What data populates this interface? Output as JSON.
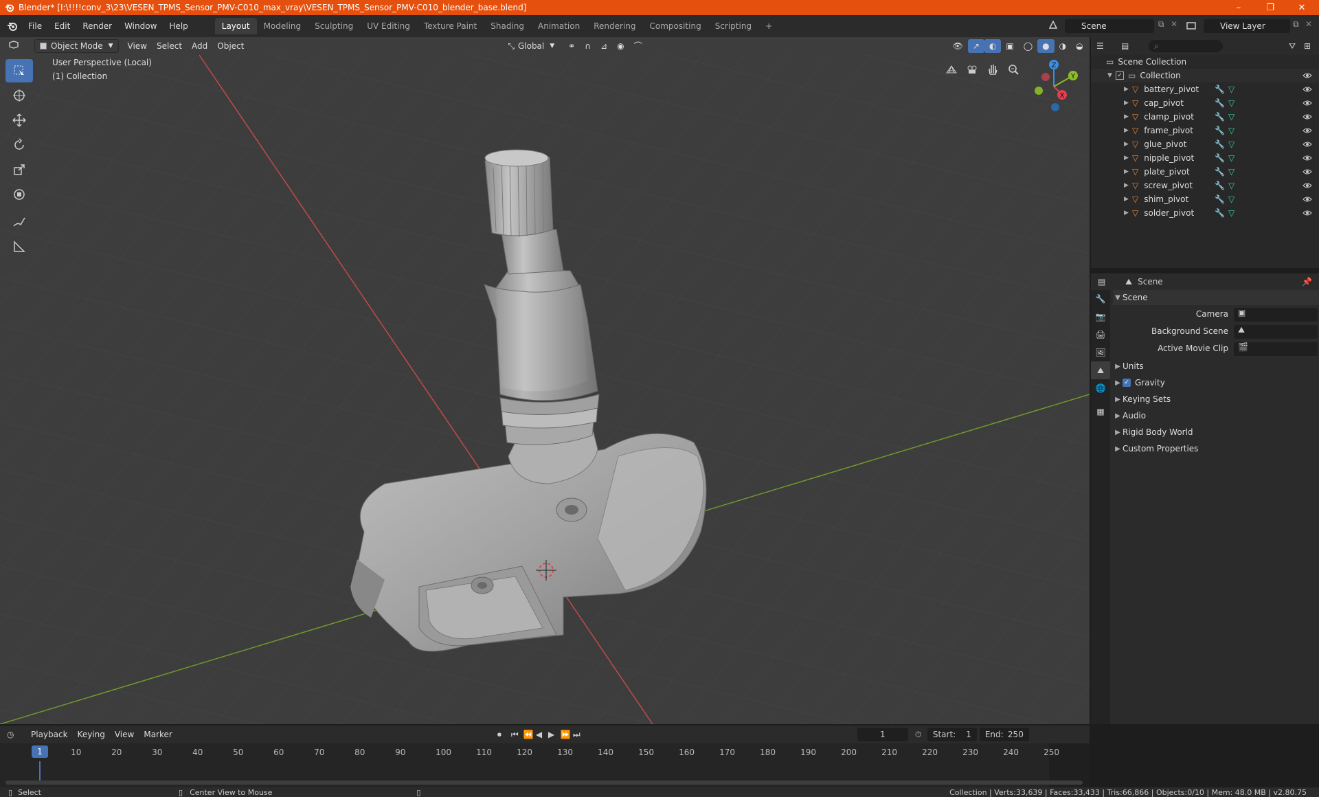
{
  "window": {
    "title": "Blender* [I:\\!!!!conv_3\\23\\VESEN_TPMS_Sensor_PMV-C010_max_vray\\VESEN_TPMS_Sensor_PMV-C010_blender_base.blend]",
    "minimize": "–",
    "maximize": "❐",
    "close": "✕"
  },
  "menubar": {
    "items": [
      "File",
      "Edit",
      "Render",
      "Window",
      "Help"
    ],
    "workspaces": [
      "Layout",
      "Modeling",
      "Sculpting",
      "UV Editing",
      "Texture Paint",
      "Shading",
      "Animation",
      "Rendering",
      "Compositing",
      "Scripting"
    ],
    "add_workspace": "+",
    "scene": "Scene",
    "view_layer": "View Layer"
  },
  "viewport": {
    "mode": "Object Mode",
    "menus": [
      "View",
      "Select",
      "Add",
      "Object"
    ],
    "transform": "Global",
    "perspective": "User Perspective (Local)",
    "collection": "(1) Collection",
    "gizmo": {
      "x": "X",
      "y": "Y",
      "z": "Z"
    }
  },
  "outliner": {
    "root": "Scene Collection",
    "collection": "Collection",
    "objects": [
      "battery_pivot",
      "cap_pivot",
      "clamp_pivot",
      "frame_pivot",
      "glue_pivot",
      "nipple_pivot",
      "plate_pivot",
      "screw_pivot",
      "shim_pivot",
      "solder_pivot"
    ]
  },
  "properties": {
    "context": "Scene",
    "panel": "Scene",
    "camera_label": "Camera",
    "bg_scene_label": "Background Scene",
    "movie_clip_label": "Active Movie Clip",
    "sections": [
      "Units",
      "Gravity",
      "Keying Sets",
      "Audio",
      "Rigid Body World",
      "Custom Properties"
    ]
  },
  "timeline": {
    "menus": [
      "Playback",
      "Keying",
      "View",
      "Marker"
    ],
    "current_frame": "1",
    "start_label": "Start:",
    "start": "1",
    "end_label": "End:",
    "end": "250",
    "ticks": [
      "1",
      "10",
      "20",
      "30",
      "40",
      "50",
      "60",
      "70",
      "80",
      "90",
      "100",
      "110",
      "120",
      "130",
      "140",
      "150",
      "160",
      "170",
      "180",
      "190",
      "200",
      "210",
      "220",
      "230",
      "240",
      "250"
    ]
  },
  "statusbar": {
    "select": "Select",
    "center": "Center View to Mouse",
    "stats": "Collection | Verts:33,639 | Faces:33,433 | Tris:66,866 | Objects:0/10 | Mem: 48.0 MB | v2.80.75"
  },
  "colors": {
    "titlebar": "#e6500e",
    "viewport_bg": "#3d3d3d",
    "active_tool": "#4772b3",
    "x_axis": "#e04050",
    "y_axis": "#8cbc28",
    "z_axis": "#3a8ee6"
  }
}
